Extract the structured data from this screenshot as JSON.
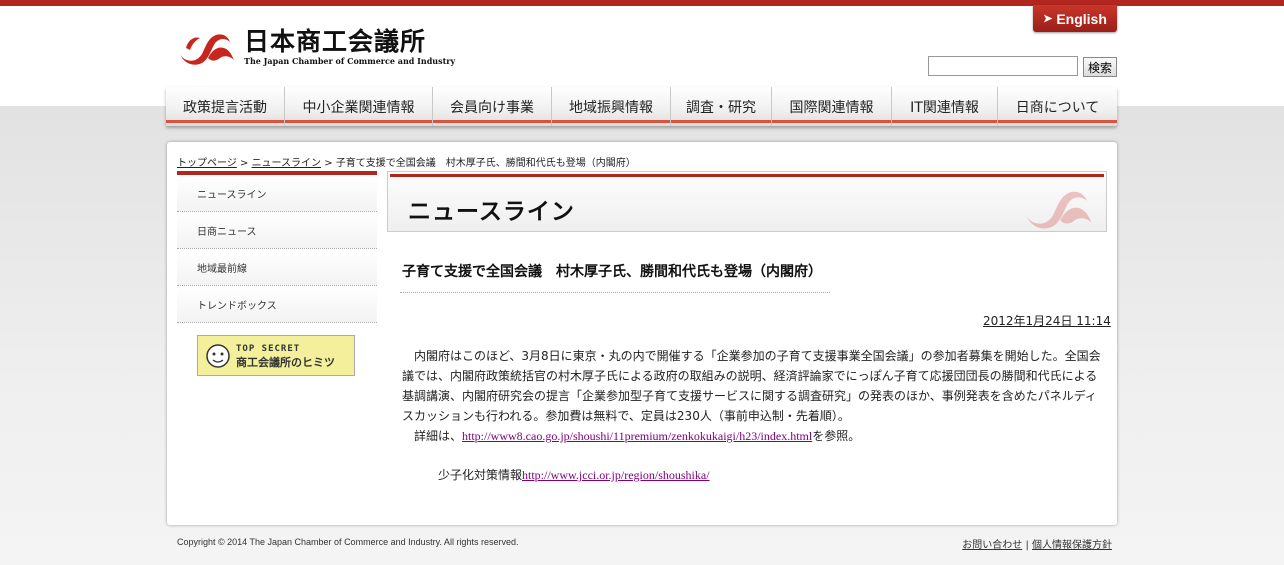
{
  "header": {
    "logo_jp": "日本商工会議所",
    "logo_en": "The Japan Chamber of Commerce and Industry",
    "english_label": "English",
    "search_value": "",
    "search_button": "検索"
  },
  "nav": [
    {
      "label": "政策提言活動"
    },
    {
      "label": "中小企業関連情報"
    },
    {
      "label": "会員向け事業"
    },
    {
      "label": "地域振興情報"
    },
    {
      "label": "調査・研究"
    },
    {
      "label": "国際関連情報"
    },
    {
      "label": "IT関連情報"
    },
    {
      "label": "日商について"
    }
  ],
  "breadcrumb": {
    "top": "トップページ",
    "sep": " > ",
    "news": "ニュースライン",
    "current": "子育て支援で全国会議　村木厚子氏、勝間和代氏も登場（内閣府）"
  },
  "sidebar": {
    "items": [
      {
        "label": "ニュースライン"
      },
      {
        "label": "日商ニュース"
      },
      {
        "label": "地域最前線"
      },
      {
        "label": "トレンドボックス"
      }
    ],
    "banner_line1": "TOP SECRET",
    "banner_line2": "商工会議所のヒミツ"
  },
  "main": {
    "page_title": "ニュースライン",
    "article_title": "子育て支援で全国会議　村木厚子氏、勝間和代氏も登場（内閣府）",
    "date": "2012年1月24日 11:14",
    "para1": "内閣府はこのほど、3月8日に東京・丸の内で開催する「企業参加の子育て支援事業全国会議」の参加者募集を開始した。全国会議では、内閣府政策統括官の村木厚子氏による政府の取組みの説明、経済評論家でにっぽん子育て応援団団長の勝間和代氏による基調講演、内閣府研究会の提言「企業参加型子育て支援サービスに関する調査研究」の発表のほか、事例発表を含めたパネルディスカッションも行われる。参加費は無料で、定員は230人（事前申込制・先着順）。",
    "para2_prefix": "詳細は、",
    "para2_link": "http://www8.cao.go.jp/shoushi/11premium/zenkokukaigi/h23/index.html",
    "para2_suffix": "を参照。",
    "shoushi_label": "少子化対策情報",
    "shoushi_link": "http://www.jcci.or.jp/region/shoushika/"
  },
  "footer": {
    "copyright": "Copyright © 2014 The Japan Chamber of Commerce and Industry. All rights reserved.",
    "contact": "お問い合わせ",
    "sep": " | ",
    "privacy": "個人情報保護方針"
  },
  "colors": {
    "brand_red": "#b3261e",
    "nav_underline": "#d9533e",
    "link_visited": "#800080"
  },
  "icons": {
    "logo": "jcci-logo-icon",
    "english_arrow": "arrow-right-icon"
  }
}
